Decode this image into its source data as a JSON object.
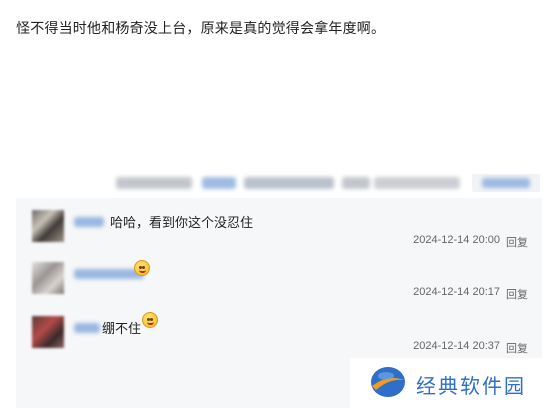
{
  "post": {
    "text": "怪不得当时他和杨奇没上台，原来是真的觉得会拿年度啊。"
  },
  "replies": [
    {
      "text": "哈哈，看到你这个没忍住",
      "time": "2024-12-14 20:00",
      "reply_label": "回复",
      "avatar_icon": "avatar-image"
    },
    {
      "text": "",
      "emoji": "grin-emoji",
      "time": "2024-12-14 20:17",
      "reply_label": "回复",
      "avatar_icon": "avatar-image"
    },
    {
      "text": "绷不住",
      "emoji": "grin-emoji",
      "time": "2024-12-14 20:37",
      "reply_label": "回复",
      "avatar_icon": "avatar-image"
    }
  ],
  "watermark": {
    "text": "经典软件园"
  },
  "colors": {
    "accent": "#2e6fc9",
    "panel_bg": "#f6f7f9",
    "muted_text": "#666666"
  }
}
